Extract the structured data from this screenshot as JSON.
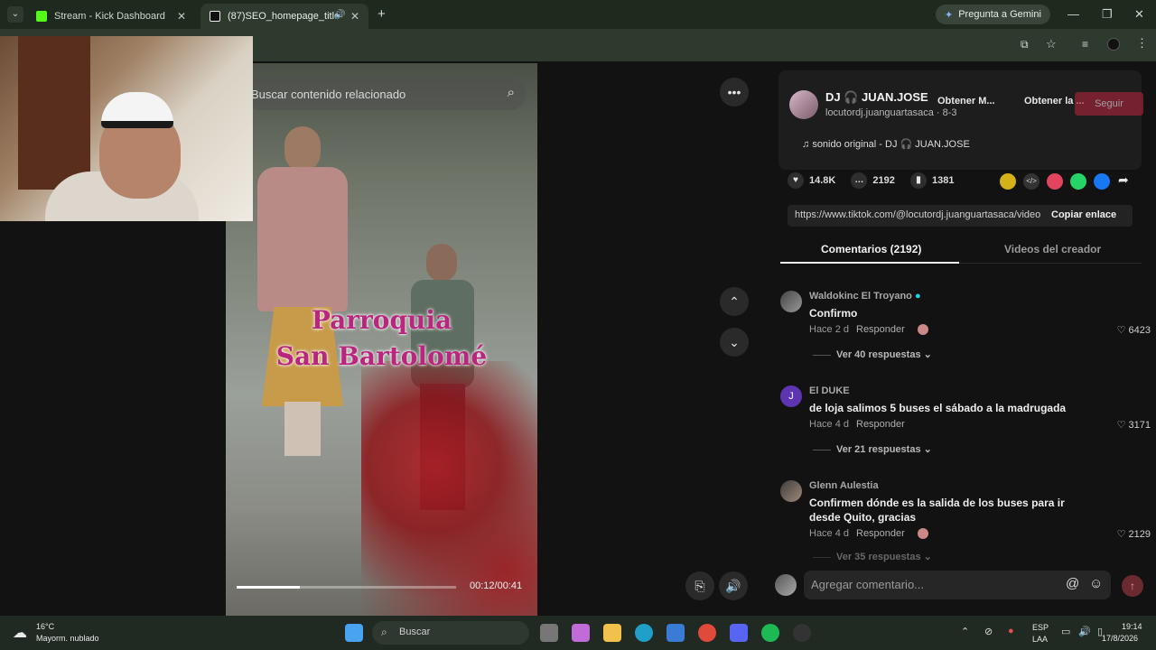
{
  "browser": {
    "tabs": [
      {
        "title": "Stream - Kick Dashboard"
      },
      {
        "title": "(87)SEO_homepage_title"
      }
    ],
    "gemini_label": "Pregunta a Gemini"
  },
  "video": {
    "search_placeholder": "Buscar contenido relacionado",
    "overlay_line1": "Parroquia",
    "overlay_line2": "San Bartolomé",
    "time": "00:12/00:41",
    "progress_fraction": 0.29
  },
  "author": {
    "name": "DJ 🎧 JUAN.JOSE",
    "handle": "locutordj.juanguartasaca · 8-3",
    "btn_get_m": "Obtener M...",
    "btn_get_la": "Obtener la ...",
    "follow": "Seguir",
    "sound": "sonido original - DJ 🎧 JUAN.JOSE"
  },
  "stats": {
    "likes": "14.8K",
    "comments": "2192",
    "saves": "1381"
  },
  "share": {
    "url": "https://www.tiktok.com/@locutordj.juanguartasaca/video/",
    "copy_label": "Copiar enlace"
  },
  "tabs": {
    "comments": "Comentarios (2192)",
    "creator": "Videos del creador"
  },
  "comments": [
    {
      "name": "Waldokinc El Troyano",
      "text": "Confirmo",
      "time": "Hace 2 d",
      "reply": "Responder",
      "likes": "6423",
      "more": "Ver 40 respuestas ⌄"
    },
    {
      "name": "El DUKE",
      "text": "de loja salimos 5 buses el sábado a la madrugada",
      "time": "Hace 4 d",
      "reply": "Responder",
      "likes": "3171",
      "more": "Ver 21 respuestas ⌄"
    },
    {
      "name": "Glenn Aulestia",
      "text": "Confirmen dónde es la salida de los buses para ir desde Quito, gracias",
      "time": "Hace 4 d",
      "reply": "Responder",
      "likes": "2129",
      "more": "Ver 35 respuestas ⌄"
    }
  ],
  "comment_input": {
    "placeholder": "Agregar comentario..."
  },
  "taskbar": {
    "temp": "16°C",
    "weather": "Mayorm. nublado",
    "search": "Buscar",
    "lang1": "ESP",
    "lang2": "LAA",
    "time": "19:14",
    "date": "17/8/2026"
  },
  "colors": {
    "overlay_text": "#b8267e",
    "follow": "#b0253c",
    "tabbar": "#1f2a1f"
  }
}
